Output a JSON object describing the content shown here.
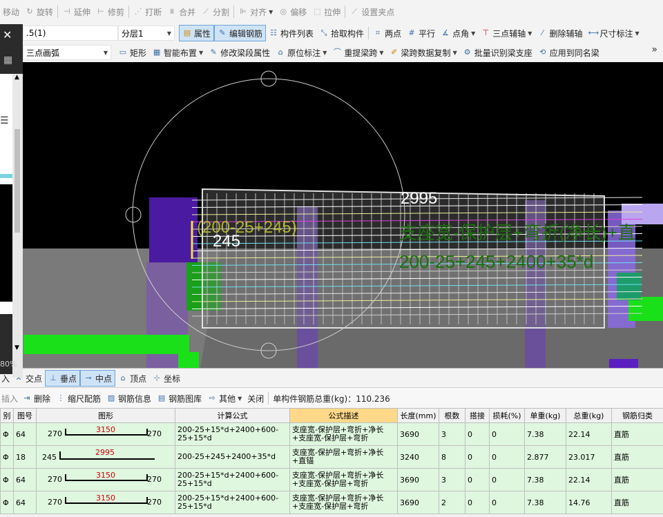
{
  "toolbar1": {
    "items": [
      "移动",
      "旋转",
      "延伸",
      "修剪",
      "打断",
      "合并",
      "分割",
      "对齐",
      "偏移",
      "拉伸",
      "设置夹点"
    ]
  },
  "toolbar2": {
    "floor_combo": ".5(1)",
    "layer_combo": "分层1",
    "items": [
      "属性",
      "编辑钢筋",
      "构件列表",
      "拾取构件",
      "两点",
      "平行",
      "点角",
      "三点辅轴",
      "删除辅轴",
      "尺寸标注"
    ]
  },
  "toolbar3": {
    "draw_combo": "三点画弧",
    "items": [
      "矩形",
      "智能布置",
      "修改梁段属性",
      "原位标注",
      "重提梁跨",
      "梁跨数据复制",
      "批量识别梁支座",
      "应用到同名梁"
    ],
    "more": "»"
  },
  "side_panel": {
    "zoom": "80%"
  },
  "viewport": {
    "labels": {
      "top_dim": "2995",
      "formula_left": "(200-25+245)",
      "left_dim": "245",
      "desc_right": "支座宽-保护层+弯折(净长)+直",
      "formula_right": "200-25+245+2400+35*d"
    }
  },
  "snapbar": {
    "prefix": "入",
    "items": [
      "交点",
      "垂点",
      "中点",
      "顶点",
      "坐标"
    ]
  },
  "rebar_toolbar": {
    "prefix": "插入",
    "items": [
      "删除",
      "缩尺配筋",
      "钢筋信息",
      "钢筋图库",
      "其他",
      "关闭"
    ],
    "total_weight": "单构件钢筋总重(kg)：110.236"
  },
  "table": {
    "headers": [
      "别",
      "图号",
      "图形",
      "计算公式",
      "公式描述",
      "长度(mm)",
      "根数",
      "搭接",
      "损耗(%)",
      "单重(kg)",
      "总重(kg)",
      "钢筋归类"
    ],
    "rows": [
      {
        "grade": "Φ",
        "figno": "64",
        "left": "270",
        "mid": "3150",
        "right": "270",
        "formula": "200-25+15*d+2400+600-25+15*d",
        "desc": "支座宽-保护层+弯折+净长+支座宽-保护层+弯折",
        "length": "3690",
        "count": "3",
        "lap": "0",
        "loss": "0",
        "unit": "7.38",
        "total": "22.14",
        "cat": "直筋"
      },
      {
        "grade": "Φ",
        "figno": "18",
        "left": "245",
        "mid": "2995",
        "right": "",
        "formula": "200-25+245+2400+35*d",
        "desc": "支座宽-保护层+弯折+净长+直锚",
        "length": "3240",
        "count": "8",
        "lap": "0",
        "loss": "0",
        "unit": "2.877",
        "total": "23.017",
        "cat": "直筋"
      },
      {
        "grade": "Φ",
        "figno": "64",
        "left": "270",
        "mid": "3150",
        "right": "270",
        "formula": "200-25+15*d+2400+600-25+15*d",
        "desc": "支座宽-保护层+弯折+净长+支座宽-保护层+弯折",
        "length": "3690",
        "count": "3",
        "lap": "0",
        "loss": "0",
        "unit": "7.38",
        "total": "22.14",
        "cat": "直筋"
      },
      {
        "grade": "Φ",
        "figno": "64",
        "left": "270",
        "mid": "3150",
        "right": "270",
        "formula": "200-25+15*d+2400+600-25+15*d",
        "desc": "支座宽-保护层+弯折+净长+支座宽-保护层+弯折",
        "length": "3690",
        "count": "2",
        "lap": "0",
        "loss": "0",
        "unit": "7.38",
        "total": "14.76",
        "cat": "直筋"
      }
    ]
  }
}
